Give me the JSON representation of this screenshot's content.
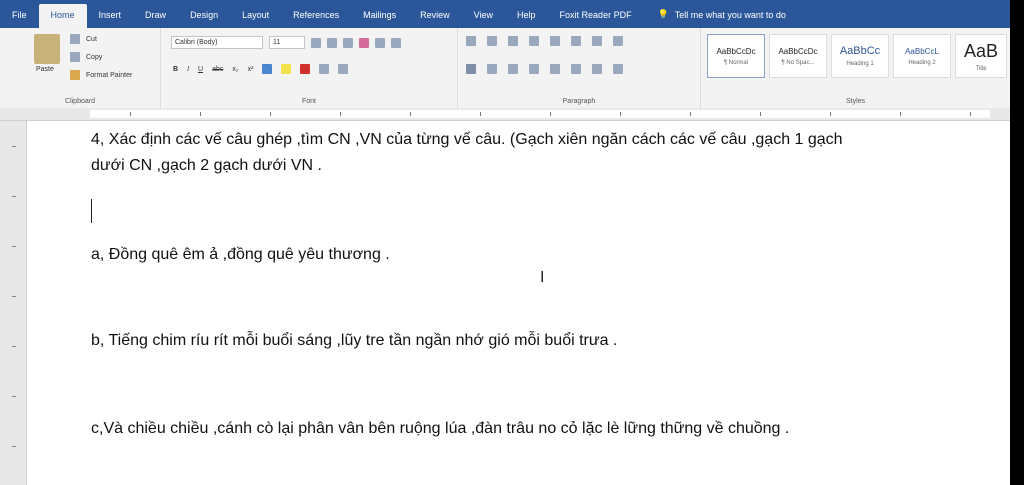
{
  "tabs": [
    "File",
    "Home",
    "Insert",
    "Draw",
    "Design",
    "Layout",
    "References",
    "Mailings",
    "Review",
    "View",
    "Help",
    "Foxit Reader PDF"
  ],
  "active_tab": "Home",
  "tell_me": "Tell me what you want to do",
  "clipboard": {
    "paste": "Paste",
    "cut": "Cut",
    "copy": "Copy",
    "format_painter": "Format Painter",
    "label": "Clipboard"
  },
  "font": {
    "name": "Calibri (Body)",
    "size": "11",
    "label": "Font"
  },
  "paragraph": {
    "label": "Paragraph"
  },
  "styles": {
    "label": "Styles",
    "items": [
      {
        "sample": "AaBbCcDc",
        "name": "¶ Normal"
      },
      {
        "sample": "AaBbCcDc",
        "name": "¶ No Spac..."
      },
      {
        "sample": "AaBbCc",
        "name": "Heading 1"
      },
      {
        "sample": "AaBbCcL",
        "name": "Heading 2"
      },
      {
        "sample": "AaB",
        "name": "Title"
      }
    ]
  },
  "document": {
    "line1": "4, Xác định các vế câu ghép ,tìm CN ,VN của từng vế câu. (Gạch xiên ngăn cách các vế câu ,gạch 1 gạch",
    "line2": "dưới CN ,gạch 2 gạch dưới VN .",
    "a": "a, Đồng quê êm ả ,đồng quê yêu thương .",
    "b": "b, Tiếng chim ríu rít mỗi buổi sáng ,lũy tre tần ngần nhớ gió mỗi buổi trưa .",
    "c": "c,Và chiều chiều ,cánh cò lại phân vân bên ruộng lúa ,đàn trâu no cỏ  lặc lè lững thững về chuồng ."
  }
}
